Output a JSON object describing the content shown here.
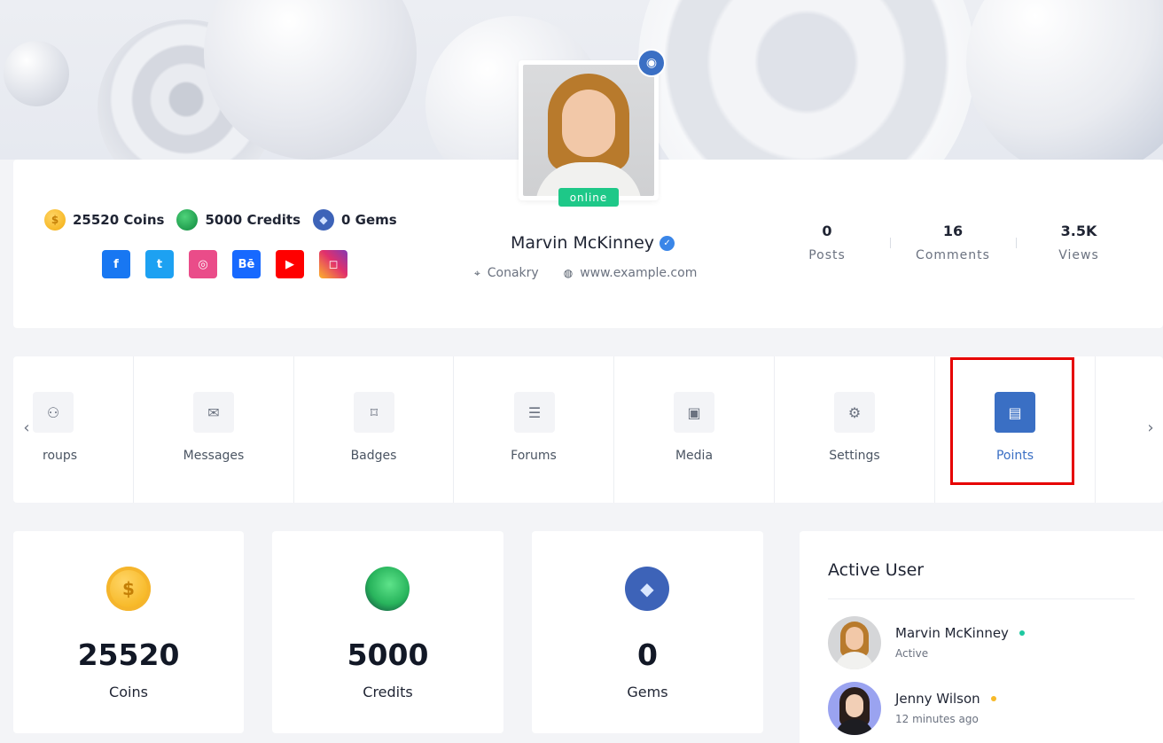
{
  "colors": {
    "primary": "#3a6fc4",
    "online": "#1ec888",
    "highlight": "#e60000"
  },
  "profile": {
    "currencies": [
      {
        "icon": "coin-icon",
        "glyph": "$",
        "label": "25520 Coins"
      },
      {
        "icon": "credits-icon",
        "glyph": "",
        "label": "5000 Credits"
      },
      {
        "icon": "gem-icon",
        "glyph": "◆",
        "label": "0 Gems"
      }
    ],
    "socials": [
      {
        "name": "facebook-icon",
        "glyph": "f"
      },
      {
        "name": "twitter-icon",
        "glyph": "t"
      },
      {
        "name": "dribbble-icon",
        "glyph": "◎"
      },
      {
        "name": "behance-icon",
        "glyph": "Bē"
      },
      {
        "name": "youtube-icon",
        "glyph": "▶"
      },
      {
        "name": "instagram-icon",
        "glyph": "◻"
      }
    ],
    "camera_glyph": "◉",
    "online_label": "online",
    "name": "Marvin McKinney",
    "verified_glyph": "✓",
    "location_glyph": "⌖",
    "location": "Conakry",
    "website_glyph": "◍",
    "website": "www.example.com",
    "stats": [
      {
        "value": "0",
        "label": "Posts"
      },
      {
        "value": "16",
        "label": "Comments"
      },
      {
        "value": "3.5K",
        "label": "Views"
      }
    ]
  },
  "tabs": {
    "prev_glyph": "‹",
    "next_glyph": "›",
    "items": [
      {
        "label": "roups",
        "icon": "groups-icon",
        "glyph": "⚇"
      },
      {
        "label": "Messages",
        "icon": "mail-icon",
        "glyph": "✉"
      },
      {
        "label": "Badges",
        "icon": "bookmark-icon",
        "glyph": "⌑"
      },
      {
        "label": "Forums",
        "icon": "forum-icon",
        "glyph": "☰"
      },
      {
        "label": "Media",
        "icon": "image-icon",
        "glyph": "▣"
      },
      {
        "label": "Settings",
        "icon": "gear-icon",
        "glyph": "⚙"
      },
      {
        "label": "Points",
        "icon": "document-icon",
        "glyph": "▤"
      }
    ]
  },
  "points": [
    {
      "value": "25520",
      "label": "Coins",
      "glyph": "$"
    },
    {
      "value": "5000",
      "label": "Credits",
      "glyph": ""
    },
    {
      "value": "0",
      "label": "Gems",
      "glyph": "◆"
    }
  ],
  "active_users": {
    "title": "Active User",
    "users": [
      {
        "name": "Marvin McKinney",
        "status": "Active"
      },
      {
        "name": "Jenny Wilson",
        "status": "12 minutes ago"
      }
    ]
  }
}
